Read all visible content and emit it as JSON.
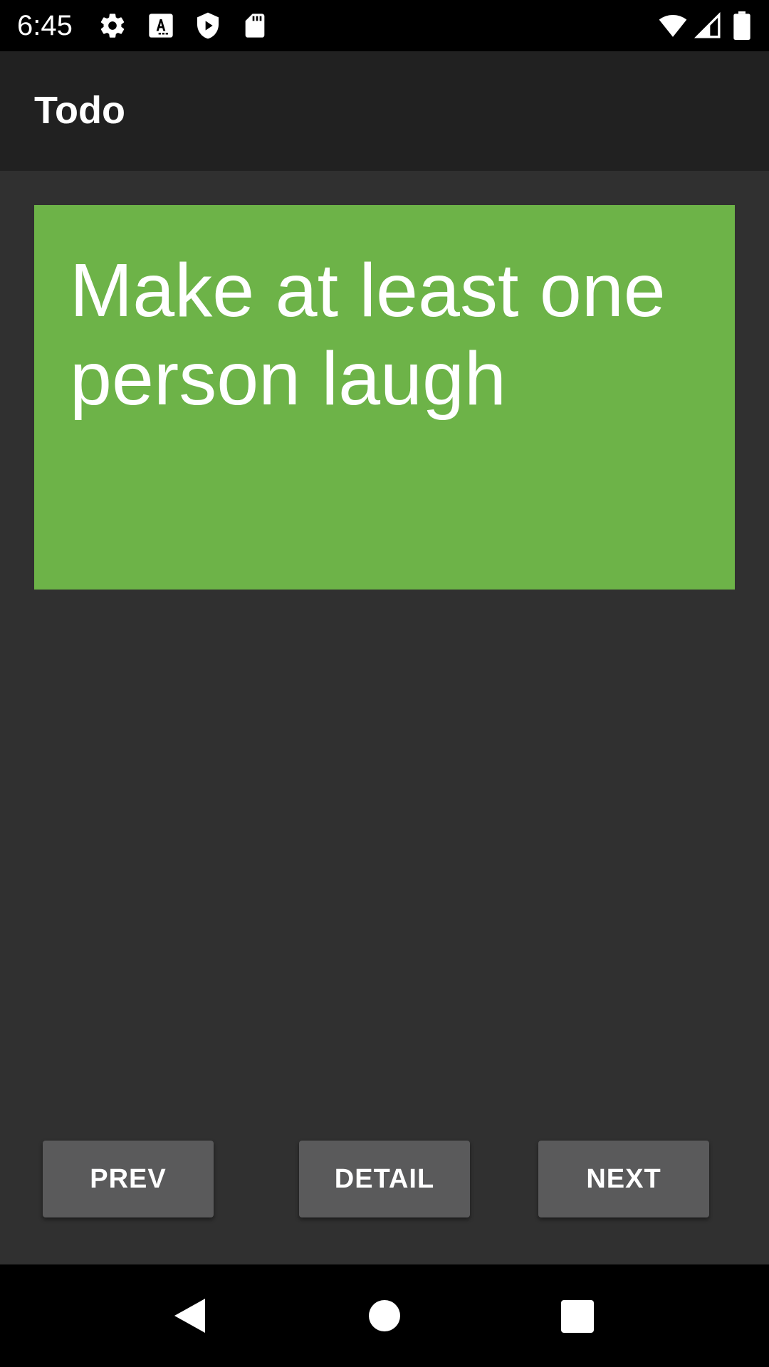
{
  "status_bar": {
    "time": "6:45",
    "left_icons": [
      "settings-gear-icon",
      "text-a-icon",
      "shield-play-icon",
      "sd-card-icon"
    ],
    "right_icons": [
      "wifi-icon",
      "cell-signal-icon",
      "battery-icon"
    ]
  },
  "app_bar": {
    "title": "Todo"
  },
  "card": {
    "text": "Make at least one person laugh",
    "background_color": "#6db348"
  },
  "buttons": {
    "prev_label": "PREV",
    "detail_label": "DETAIL",
    "next_label": "NEXT"
  },
  "nav_bar": {
    "icons": [
      "back-icon",
      "home-icon",
      "recents-icon"
    ]
  }
}
